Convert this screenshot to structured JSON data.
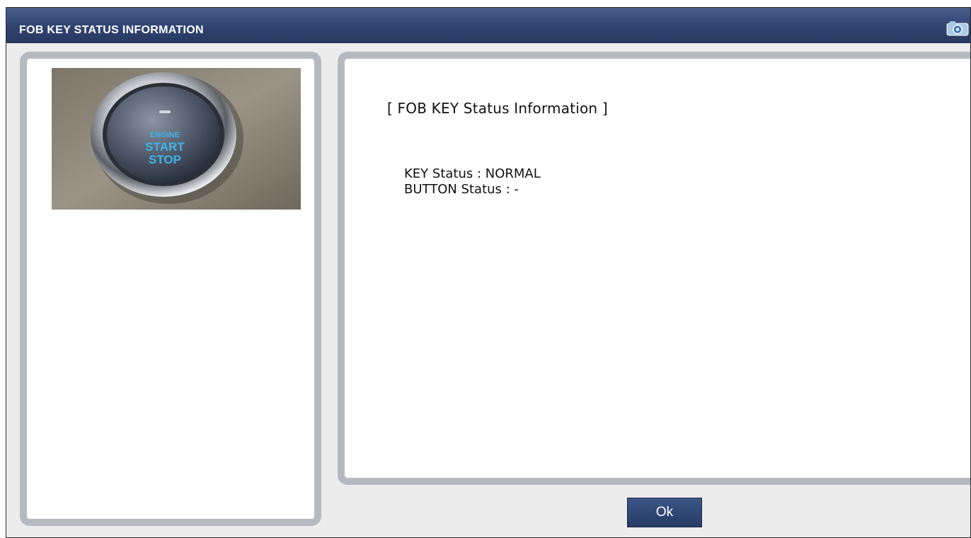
{
  "window": {
    "title": "FOB KEY STATUS INFORMATION"
  },
  "image_panel": {
    "button_image": {
      "icon": "engine-start-stop-button-photo",
      "text_line1": "ENGINE",
      "text_line2": "START",
      "text_line3": "STOP"
    }
  },
  "info_panel": {
    "heading": "[ FOB KEY Status Information ]",
    "key_status": "KEY Status : NORMAL",
    "button_status": "BUTTON Status : -"
  },
  "footer": {
    "ok_label": "Ok"
  },
  "colors": {
    "titlebar": "#2f4370",
    "panel_border": "#b7b9c0",
    "button_bg": "#2e4775",
    "button_glow": "#3fb4e8"
  }
}
